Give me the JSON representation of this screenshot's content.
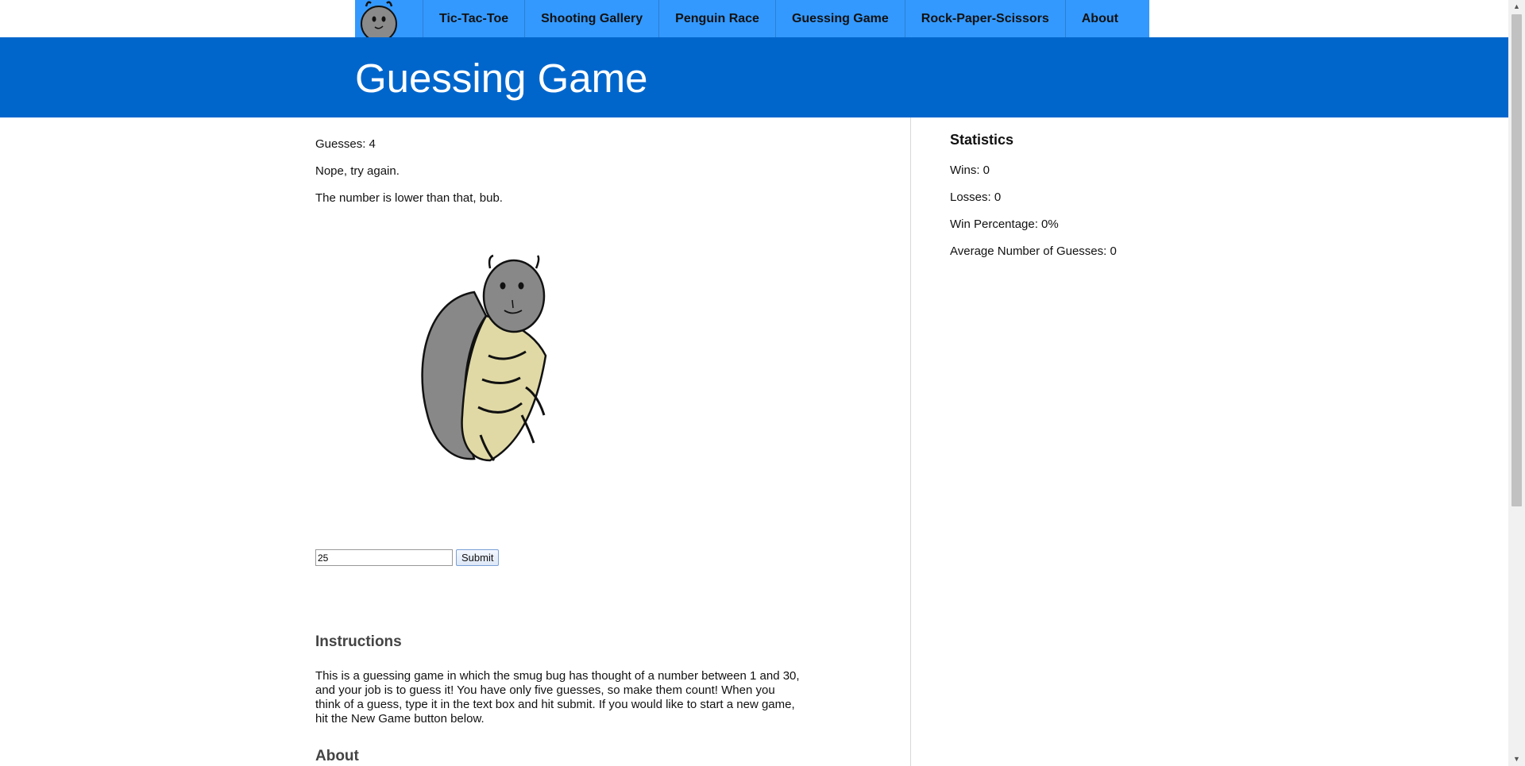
{
  "nav": {
    "items": [
      {
        "label": "Tic-Tac-Toe"
      },
      {
        "label": "Shooting Gallery"
      },
      {
        "label": "Penguin Race"
      },
      {
        "label": "Guessing Game"
      },
      {
        "label": "Rock-Paper-Scissors"
      },
      {
        "label": "About"
      }
    ],
    "logo_icon": "bug-logo-icon"
  },
  "banner": {
    "title": "Guessing Game"
  },
  "game": {
    "guesses_label": "Guesses: 4",
    "feedback": "Nope, try again.",
    "hint": "The number is lower than that, bub.",
    "input_value": "25",
    "submit_label": "Submit"
  },
  "instructions": {
    "heading": "Instructions",
    "text": "This is a guessing game in which the smug bug has thought of a number between 1 and 30, and your job is to guess it! You have only five guesses, so make them count! When you think of a guess, type it in the text box and hit submit. If you would like to start a new game, hit the New Game button below."
  },
  "about": {
    "heading": "About"
  },
  "stats": {
    "title": "Statistics",
    "wins": "Wins: 0",
    "losses": "Losses: 0",
    "win_pct": "Win Percentage: 0%",
    "avg_guesses": "Average Number of Guesses: 0"
  },
  "colors": {
    "nav_bg": "#3399ff",
    "banner_bg": "#0066cc",
    "bug_body": "#888888",
    "bug_belly": "#e0d9a5"
  }
}
